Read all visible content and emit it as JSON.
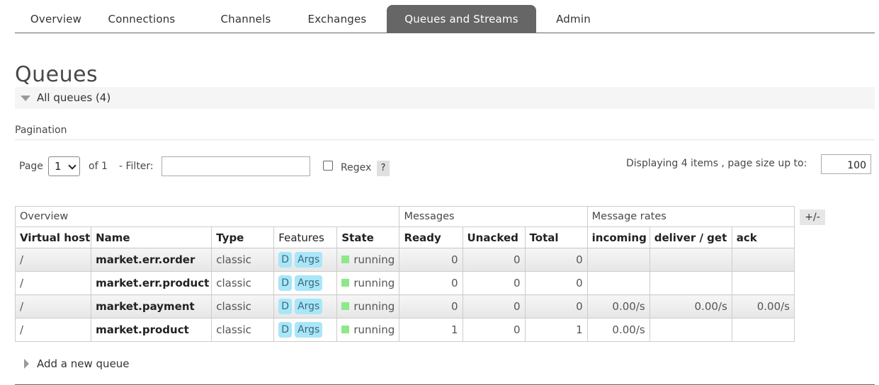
{
  "nav": {
    "tabs": [
      {
        "label": "Overview"
      },
      {
        "label": "Connections"
      },
      {
        "label": "Channels"
      },
      {
        "label": "Exchanges"
      },
      {
        "label": "Queues and Streams",
        "active": true
      },
      {
        "label": "Admin"
      }
    ]
  },
  "page": {
    "title": "Queues",
    "section_label": "All queues (4)"
  },
  "pagination": {
    "label": "Pagination",
    "page_label": "Page",
    "page_value": "1",
    "of_label": "of 1",
    "filter_label": "- Filter:",
    "filter_value": "",
    "regex_label": "Regex",
    "regex_checked": false,
    "help_label": "?",
    "displaying_label": "Displaying 4 items , page size up to:",
    "page_size": "100"
  },
  "table": {
    "groups": [
      "Overview",
      "Messages",
      "Message rates"
    ],
    "columns": [
      "Virtual host",
      "Name",
      "Type",
      "Features",
      "State",
      "Ready",
      "Unacked",
      "Total",
      "incoming",
      "deliver / get",
      "ack"
    ],
    "toggle_label": "+/-",
    "rows": [
      {
        "vhost": "/",
        "name": "market.err.order",
        "type": "classic",
        "features": [
          "D",
          "Args"
        ],
        "state": "running",
        "ready": "0",
        "unacked": "0",
        "total": "0",
        "incoming": "",
        "deliver_get": "",
        "ack": ""
      },
      {
        "vhost": "/",
        "name": "market.err.product",
        "type": "classic",
        "features": [
          "D",
          "Args"
        ],
        "state": "running",
        "ready": "0",
        "unacked": "0",
        "total": "0",
        "incoming": "",
        "deliver_get": "",
        "ack": ""
      },
      {
        "vhost": "/",
        "name": "market.payment",
        "type": "classic",
        "features": [
          "D",
          "Args"
        ],
        "state": "running",
        "ready": "0",
        "unacked": "0",
        "total": "0",
        "incoming": "0.00/s",
        "deliver_get": "0.00/s",
        "ack": "0.00/s"
      },
      {
        "vhost": "/",
        "name": "market.product",
        "type": "classic",
        "features": [
          "D",
          "Args"
        ],
        "state": "running",
        "ready": "1",
        "unacked": "0",
        "total": "1",
        "incoming": "0.00/s",
        "deliver_get": "",
        "ack": ""
      }
    ]
  },
  "add_queue": {
    "label": "Add a new queue"
  },
  "colors": {
    "active_tab": "#666666",
    "badge": "#a8e6f8",
    "running": "#8ee88a"
  },
  "icons": {
    "section_toggle": "triangle-down-icon",
    "add_queue_toggle": "triangle-right-icon",
    "page_select": "chevron-down-icon"
  }
}
